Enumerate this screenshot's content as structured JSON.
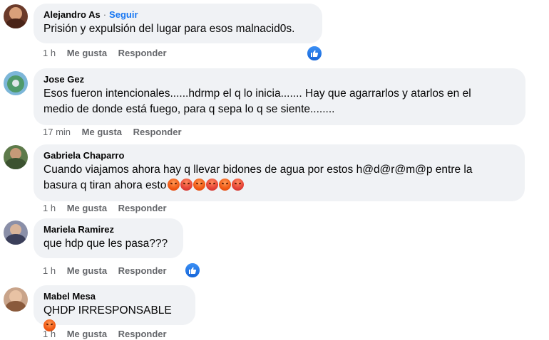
{
  "comments": [
    {
      "author": "Alejandro As",
      "follow": "Seguir",
      "text": "Prisión y expulsión del lugar para esos malnacid0s.",
      "time": "1 h",
      "like": "Me gusta",
      "reply": "Responder",
      "has_reaction": true
    },
    {
      "author": "Jose Gez",
      "text_line1": "Esos fueron intencionales......hdrmp el q lo inicia....... Hay que agarrarlos y atarlos en el",
      "text_line2": "medio de donde está fuego, para q sepa lo q se siente........",
      "time": "17 min",
      "like": "Me gusta",
      "reply": "Responder"
    },
    {
      "author": "Gabriela Chaparro",
      "text_line1": "Cuando viajamos ahora hay q llevar bidones de agua por estos h@d@r@m@p entre la",
      "text_line2": "basura q tiran ahora esto",
      "emojis": [
        "angry-face",
        "cursing-face",
        "angry-face",
        "cursing-face",
        "angry-face",
        "cursing-face"
      ],
      "time": "1 h",
      "like": "Me gusta",
      "reply": "Responder"
    },
    {
      "author": "Mariela Ramirez",
      "text": "que hdp que les pasa???",
      "time": "1 h",
      "like": "Me gusta",
      "reply": "Responder",
      "has_reaction": true
    },
    {
      "author": "Mabel Mesa",
      "text": "QHDP IRRESPONSABLE",
      "emojis": [
        "angry-face"
      ],
      "time": "1 h",
      "like": "Me gusta",
      "reply": "Responder"
    }
  ],
  "colors": {
    "bubble": "#f0f2f5",
    "follow": "#1877f2",
    "meta": "#65676b",
    "like_badge": "#1877f2"
  }
}
